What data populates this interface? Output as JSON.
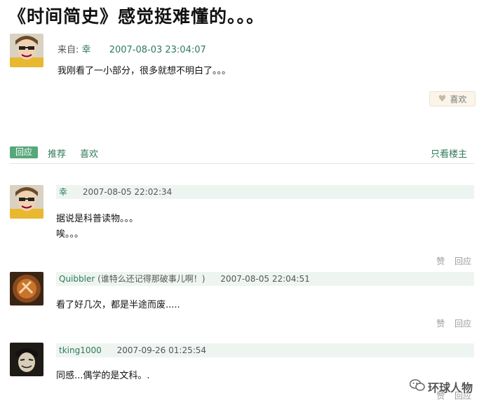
{
  "title": "《时间简史》感觉挺难懂的。。。",
  "post": {
    "from_label": "来自:",
    "author": "幸",
    "date": "2007-08-03 23:04:07",
    "text": "我刚看了一小部分，很多就想不明白了。。。",
    "like_label": "喜欢"
  },
  "actions": {
    "reply": "回应",
    "recommend": "推荐",
    "like": "喜欢",
    "author_only": "只看楼主"
  },
  "comments": [
    {
      "author": "幸",
      "note": "",
      "date": "2007-08-05 22:02:34",
      "lines": [
        "据说是科普读物。。。",
        "唉。。。"
      ],
      "like_label": "赞",
      "reply_label": "回应"
    },
    {
      "author": "Quibbler",
      "note": " (谁特么还记得那破事儿啊！)",
      "date": "2007-08-05 22:04:51",
      "lines": [
        "看了好几次，都是半途而废....."
      ],
      "like_label": "赞",
      "reply_label": "回应"
    },
    {
      "author": "tking1000",
      "note": "",
      "date": "2007-09-26 01:25:54",
      "lines": [
        "同感...偶学的是文科。."
      ],
      "like_label": "赞",
      "reply_label": "回应"
    }
  ],
  "watermark": "环球人物",
  "colors": {
    "accent": "#2f7a5a",
    "reply_button": "#56a77a",
    "comment_bar": "#eef5f1"
  }
}
